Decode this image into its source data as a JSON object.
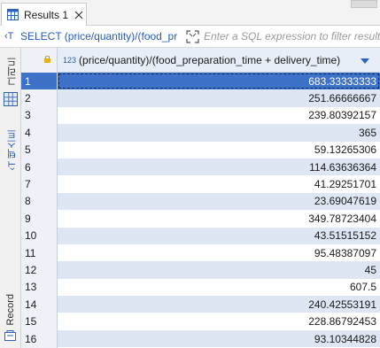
{
  "tabs": [
    {
      "label": "Results 1",
      "icon": "table-icon",
      "closable": true
    }
  ],
  "filter_bar": {
    "sql_prefix": "‹T",
    "sql_text": "SELECT (price/quantity)/(food_pr",
    "placeholder": "Enter a SQL expression to filter results"
  },
  "sidebar": {
    "grid_label": "그리드",
    "text_label": "텍스트",
    "text_icon": "‹T",
    "record_label": "Record"
  },
  "grid": {
    "column": {
      "type_badge": "123",
      "name": "(price/quantity)/(food_preparation_time + delivery_time)"
    },
    "rows": [
      {
        "n": "1",
        "value": "683.33333333"
      },
      {
        "n": "2",
        "value": "251.66666667"
      },
      {
        "n": "3",
        "value": "239.80392157"
      },
      {
        "n": "4",
        "value": "365"
      },
      {
        "n": "5",
        "value": "59.13265306"
      },
      {
        "n": "6",
        "value": "114.63636364"
      },
      {
        "n": "7",
        "value": "41.29251701"
      },
      {
        "n": "8",
        "value": "23.69047619"
      },
      {
        "n": "9",
        "value": "349.78723404"
      },
      {
        "n": "10",
        "value": "43.51515152"
      },
      {
        "n": "11",
        "value": "95.48387097"
      },
      {
        "n": "12",
        "value": "45"
      },
      {
        "n": "13",
        "value": "607.5"
      },
      {
        "n": "14",
        "value": "240.42553191"
      },
      {
        "n": "15",
        "value": "228.86792453"
      },
      {
        "n": "16",
        "value": "93.10344828"
      }
    ],
    "selected_row": 1
  },
  "colors": {
    "selection": "#3d72c8",
    "accent": "#2a5ab8",
    "stripe": "#dde6f2"
  }
}
